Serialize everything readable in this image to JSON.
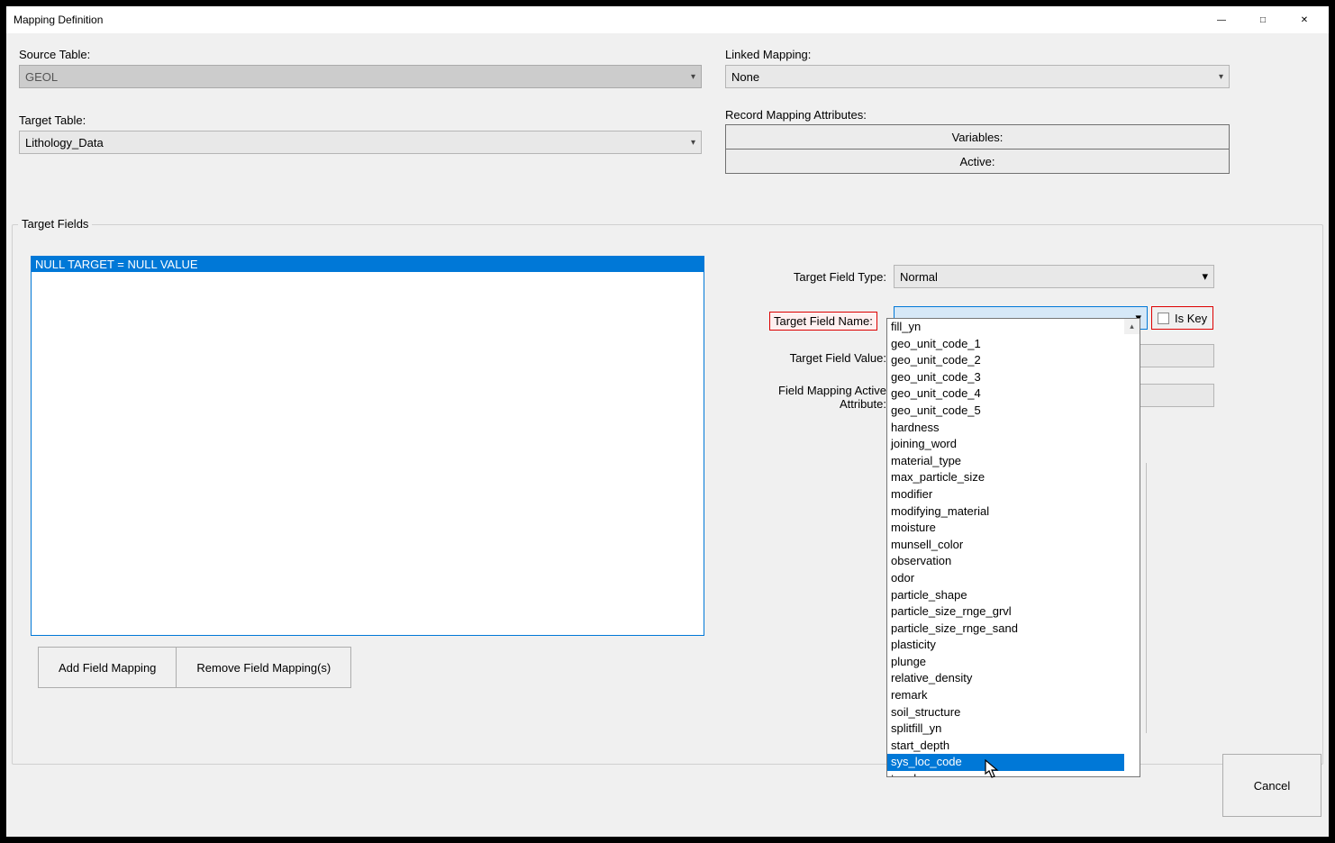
{
  "window": {
    "title": "Mapping Definition"
  },
  "top": {
    "source_table_label": "Source Table:",
    "source_table_value": "GEOL",
    "target_table_label": "Target Table:",
    "target_table_value": "Lithology_Data",
    "linked_mapping_label": "Linked Mapping:",
    "linked_mapping_value": "None",
    "record_mapping_label": "Record Mapping Attributes:",
    "variables_label": "Variables:",
    "active_label": "Active:"
  },
  "fieldset": {
    "legend": "Target Fields",
    "list_item": "NULL TARGET = NULL VALUE",
    "add_button": "Add Field Mapping",
    "remove_button": "Remove Field Mapping(s)",
    "target_field_type_label": "Target Field Type:",
    "target_field_type_value": "Normal",
    "target_field_name_label": "Target Field Name:",
    "target_field_name_value": "",
    "is_key_label": "Is Key",
    "target_field_value_label": "Target Field Value:",
    "mapping_active_label_l1": "Field Mapping Active",
    "mapping_active_label_l2": "Attribute:"
  },
  "dropdown_items": [
    "fill_yn",
    "geo_unit_code_1",
    "geo_unit_code_2",
    "geo_unit_code_3",
    "geo_unit_code_4",
    "geo_unit_code_5",
    "hardness",
    "joining_word",
    "material_type",
    "max_particle_size",
    "modifier",
    "modifying_material",
    "moisture",
    "munsell_color",
    "observation",
    "odor",
    "particle_shape",
    "particle_size_rnge_grvl",
    "particle_size_rnge_sand",
    "plasticity",
    "plunge",
    "relative_density",
    "remark",
    "soil_structure",
    "splitfill_yn",
    "start_depth",
    "sys_loc_code",
    "toughness"
  ],
  "dropdown_selected_index": 26,
  "footer": {
    "cancel": "Cancel"
  }
}
